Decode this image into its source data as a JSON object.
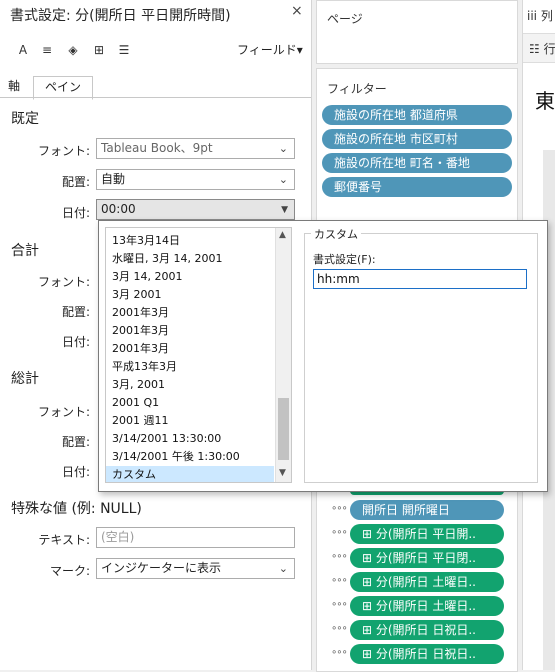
{
  "format_pane": {
    "title": "書式設定: 分(開所日 平日開所時間)",
    "close": "×",
    "toolbar": {
      "font_icon": "A",
      "align_icon": "≡",
      "fill_icon": "◈",
      "border_icon": "⊞",
      "lines_icon": "☰",
      "fields_label": "フィールド▾"
    },
    "tabs": [
      "軸",
      "ペイン"
    ],
    "sections": {
      "default": {
        "title": "既定",
        "font_label": "フォント:",
        "font_value": "Tableau Book、9pt",
        "align_label": "配置:",
        "align_value": "自動",
        "date_label": "日付:",
        "date_value": "00:00"
      },
      "total": {
        "title": "合計",
        "font_label": "フォント:",
        "align_label": "配置:",
        "date_label": "日付:"
      },
      "grand_total": {
        "title": "総計",
        "font_label": "フォント:",
        "align_label": "配置:",
        "date_label": "日付:"
      },
      "special": {
        "title": "特殊な値 (例: NULL)",
        "text_label": "テキスト:",
        "text_placeholder": "(空白)",
        "mark_label": "マーク:",
        "mark_value": "インジケーターに表示"
      }
    },
    "chevron": "⌄"
  },
  "date_popup": {
    "formats": [
      "13年3月14日",
      "水曜日, 3月 14, 2001",
      "3月 14, 2001",
      "3月 2001",
      "2001年3月",
      "2001年3月",
      "2001年3月",
      "平成13年3月",
      "3月, 2001",
      "2001 Q1",
      "2001 週11",
      "3/14/2001 13:30:00",
      "3/14/2001 午後 1:30:00",
      "カスタム"
    ],
    "selected_index": 13,
    "custom_group_title": "カスタム",
    "format_label": "書式設定(F):",
    "format_value": "hh:mm",
    "scroll_up": "▲",
    "scroll_down": "▼"
  },
  "shelves": {
    "pages_title": "ページ",
    "filters_title": "フィルター",
    "filters": [
      "施設の所在地 都道府県",
      "施設の所在地 市区町村",
      "施設の所在地 町名・番地",
      "郵便番号"
    ],
    "marks": [
      "開所日 開所曜日",
      "⊞ 分(開所日 平日開..",
      "⊞ 分(開所日 平日閉..",
      "⊞ 分(開所日 土曜日..",
      "⊞ 分(開所日 土曜日..",
      "⊞ 分(開所日 日祝日..",
      "⊞ 分(開所日 日祝日.."
    ],
    "dots": "∘∘∘"
  },
  "right_panel": {
    "top_label": "iii 列",
    "sub_label": "☷ 行",
    "big_text": "東"
  },
  "colors": {
    "filter_pill": "#4f96b8",
    "mark_pill": "#12a36f",
    "selected_row": "#cce8ff",
    "input_focus": "#1c6fc7"
  }
}
